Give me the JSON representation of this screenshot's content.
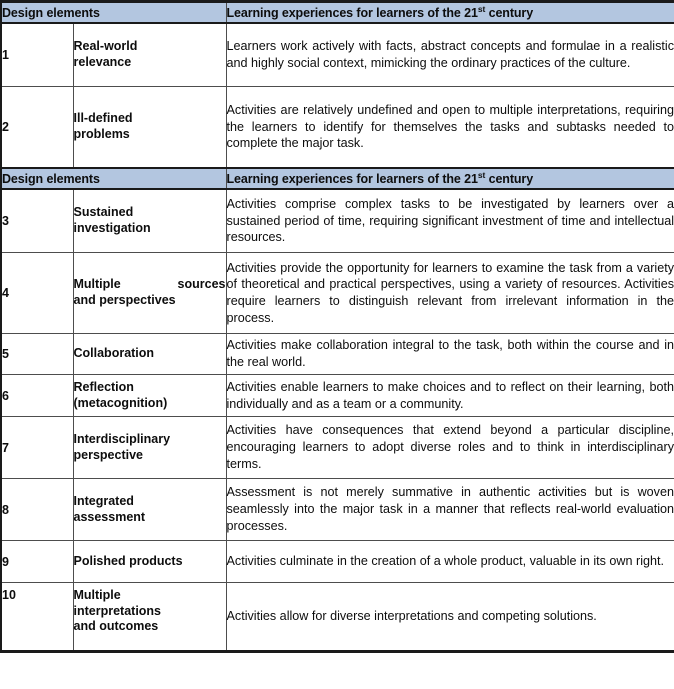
{
  "document": {
    "type": "table",
    "title": "Design elements and learning experiences table",
    "accent_header_color": "#b3c6e0",
    "text_color": "#0d0d0d",
    "border_color": "#4d4d4d"
  },
  "headers": {
    "col_num": "",
    "col_element": "Design elements",
    "col_experience_prefix": "Learning experiences for learners of the 21",
    "col_experience_sup": "st",
    "col_experience_suffix": " century"
  },
  "rows": [
    {
      "num": "1",
      "element_line1": "Real-world",
      "element_line2": "relevance",
      "description": "Learners work actively with facts, abstract concepts and formulae in a realistic and highly social context, mimicking the ordinary practices of the culture."
    },
    {
      "num": "2",
      "element_line1": "Ill-defined",
      "element_line2": "problems",
      "description": "Activities are relatively undefined and open to multiple interpretations, requiring the learners to identify for themselves the tasks and subtasks needed to complete the major task."
    },
    {
      "num": "3",
      "element_line1": "Sustained",
      "element_line2": "investigation",
      "description": "Activities comprise complex tasks to be investigated by learners over a sustained period of time, requiring significant investment of time and intellectual resources."
    },
    {
      "num": "4",
      "element_line1": "Multiple",
      "element_line1b": "sources",
      "element_line2": "and perspectives",
      "description": "Activities provide the opportunity for learners to examine the task from a variety of theoretical and practical perspectives, using a variety of resources. Activities require learners to distinguish relevant from irrelevant information in the process."
    },
    {
      "num": "5",
      "element_line1": "Collaboration",
      "element_line2": "",
      "description": "Activities make collaboration integral to the task, both within the course and in the real world."
    },
    {
      "num": "6",
      "element_line1": "Reflection",
      "element_line2": "(metacognition)",
      "description": "Activities enable learners to make choices and to reflect on their learning, both individually and as a team or a community."
    },
    {
      "num": "7",
      "element_line1": "Interdisciplinary",
      "element_line2": "perspective",
      "description": "Activities have consequences that extend beyond a particular discipline, encouraging learners to adopt diverse roles and to think in interdisciplinary terms."
    },
    {
      "num": "8",
      "element_line1": "Integrated",
      "element_line2": "assessment",
      "description": "Assessment is not merely summative in authentic activities but is woven seamlessly into the major task in a manner that reflects real-world evaluation processes."
    },
    {
      "num": "9",
      "element_line1": "Polished products",
      "element_line2": "",
      "description": "Activities culminate in the creation of a whole product, valuable in its own right."
    },
    {
      "num": "10",
      "element_line1": "Multiple",
      "element_line2": "interpretations",
      "element_line3": "and outcomes",
      "description": "Activities allow for diverse interpretations and competing solutions."
    }
  ]
}
